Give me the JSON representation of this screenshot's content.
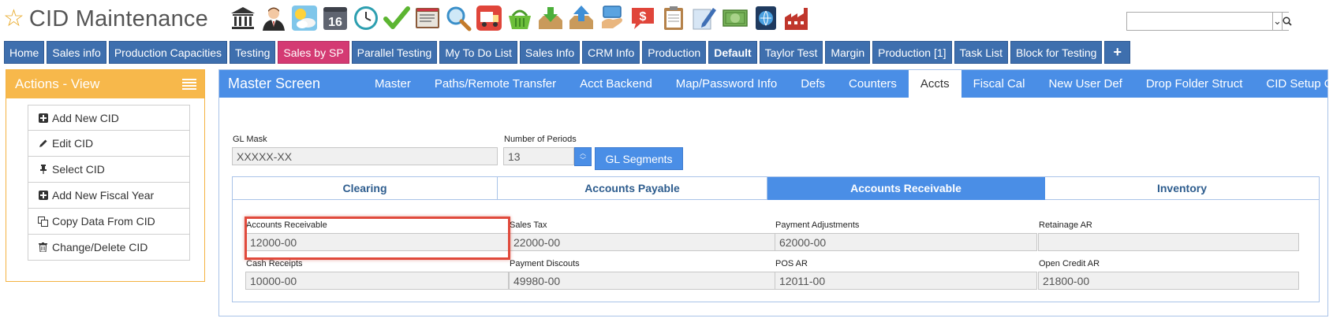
{
  "app": {
    "title": "CID Maintenance"
  },
  "toolbar": {
    "icons": [
      "bank-icon",
      "user-icon",
      "weather-icon",
      "calendar-icon",
      "clock-icon",
      "checkmark-icon",
      "terminal-icon",
      "magnifier-icon",
      "truck-icon",
      "basket-icon",
      "inbox-download-icon",
      "inbox-upload-icon",
      "hand-card-icon",
      "dollar-chat-icon",
      "clipboard-icon",
      "pencil-note-icon",
      "money-icon",
      "globe-device-icon",
      "factory-icon"
    ],
    "calendar_number": "16"
  },
  "search": {
    "value": ""
  },
  "nav_tabs": [
    {
      "label": "Home"
    },
    {
      "label": "Sales info"
    },
    {
      "label": "Production Capacities"
    },
    {
      "label": "Testing"
    },
    {
      "label": "Sales by SP"
    },
    {
      "label": "Parallel Testing"
    },
    {
      "label": "My To Do List"
    },
    {
      "label": "Sales Info"
    },
    {
      "label": "CRM Info"
    },
    {
      "label": "Production"
    },
    {
      "label": "Default"
    },
    {
      "label": "Taylor Test"
    },
    {
      "label": "Margin"
    },
    {
      "label": "Production [1]"
    },
    {
      "label": "Task List"
    },
    {
      "label": "Block for Testing"
    },
    {
      "label": "+"
    }
  ],
  "actions": {
    "title": "Actions - View",
    "items": [
      {
        "label": "Add New CID",
        "icon": "plus-square-icon"
      },
      {
        "label": "Edit CID",
        "icon": "pencil-icon"
      },
      {
        "label": "Select CID",
        "icon": "pin-icon"
      },
      {
        "label": "Add New Fiscal Year",
        "icon": "plus-square-icon"
      },
      {
        "label": "Copy Data From CID",
        "icon": "copy-icon"
      },
      {
        "label": "Change/Delete CID",
        "icon": "trash-icon"
      }
    ]
  },
  "master": {
    "title": "Master Screen",
    "tabs": [
      {
        "label": "Master"
      },
      {
        "label": "Paths/Remote Transfer"
      },
      {
        "label": "Acct Backend"
      },
      {
        "label": "Map/Password Info"
      },
      {
        "label": "Defs"
      },
      {
        "label": "Counters"
      },
      {
        "label": "Accts"
      },
      {
        "label": "Fiscal Cal"
      },
      {
        "label": "New User Def"
      },
      {
        "label": "Drop Folder Struct"
      },
      {
        "label": "CID Setup Opts"
      }
    ],
    "active_tab": "Accts",
    "gl_mask": {
      "label": "GL Mask",
      "value": "XXXXX-XX"
    },
    "periods": {
      "label": "Number of Periods",
      "value": "13"
    },
    "gl_segments_label": "GL Segments",
    "account_tabs": [
      {
        "label": "Clearing"
      },
      {
        "label": "Accounts Payable"
      },
      {
        "label": "Accounts Receivable"
      },
      {
        "label": "Inventory"
      }
    ],
    "active_account_tab": "Accounts Receivable",
    "fields": [
      {
        "label": "Accounts Receivable",
        "value": "12000-00"
      },
      {
        "label": "Sales Tax",
        "value": "22000-00"
      },
      {
        "label": "Payment Adjustments",
        "value": "62000-00"
      },
      {
        "label": "Retainage AR",
        "value": ""
      },
      {
        "label": "Cash Receipts",
        "value": "10000-00"
      },
      {
        "label": "Payment Discouts",
        "value": "49980-00"
      },
      {
        "label": "POS AR",
        "value": "12011-00"
      },
      {
        "label": "Open Credit AR",
        "value": "21800-00"
      }
    ]
  },
  "colors": {
    "accent": "#4a8ee6",
    "nav": "#3e6fae",
    "nav_highlight": "#d43a73",
    "actions": "#f7b84b",
    "highlight_border": "#e04a3c"
  }
}
